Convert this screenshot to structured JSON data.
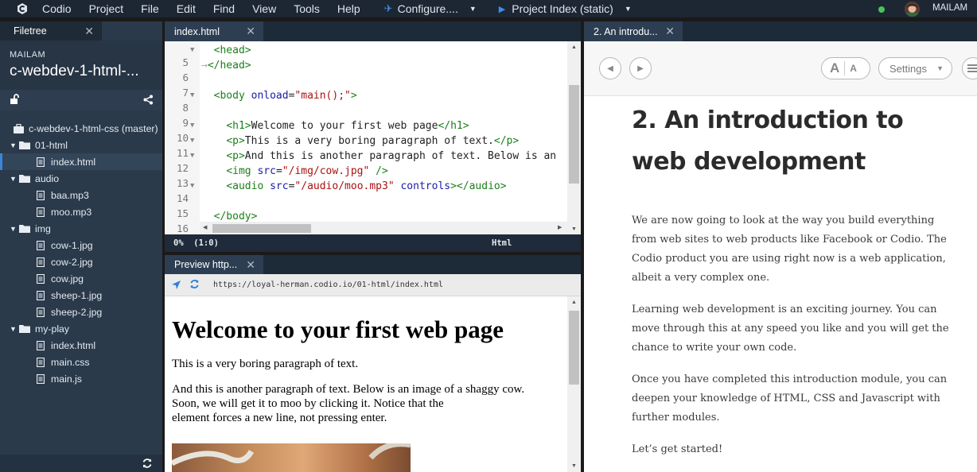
{
  "menubar": {
    "items": [
      "Codio",
      "Project",
      "File",
      "Edit",
      "Find",
      "View",
      "Tools",
      "Help"
    ],
    "configure": "Configure....",
    "project_index": "Project Index (static)",
    "user": "MAILAM"
  },
  "filetree": {
    "tab": "Filetree",
    "org": "MAILAM",
    "project": "c-webdev-1-html-...",
    "root": "c-webdev-1-html-css (master)",
    "items": [
      {
        "label": "01-html",
        "type": "folder"
      },
      {
        "label": "index.html",
        "type": "file",
        "selected": true
      },
      {
        "label": "audio",
        "type": "folder"
      },
      {
        "label": "baa.mp3",
        "type": "file"
      },
      {
        "label": "moo.mp3",
        "type": "file"
      },
      {
        "label": "img",
        "type": "folder"
      },
      {
        "label": "cow-1.jpg",
        "type": "file"
      },
      {
        "label": "cow-2.jpg",
        "type": "file"
      },
      {
        "label": "cow.jpg",
        "type": "file"
      },
      {
        "label": "sheep-1.jpg",
        "type": "file"
      },
      {
        "label": "sheep-2.jpg",
        "type": "file"
      },
      {
        "label": "my-play",
        "type": "folder"
      },
      {
        "label": "index.html",
        "type": "file"
      },
      {
        "label": "main.css",
        "type": "file"
      },
      {
        "label": "main.js",
        "type": "file"
      }
    ]
  },
  "editor": {
    "tab": "index.html",
    "lines": [
      {
        "n": "5",
        "fold": "▼"
      },
      {
        "n": "6",
        "fold": ""
      },
      {
        "n": "7",
        "fold": ""
      },
      {
        "n": "8",
        "fold": "▼"
      },
      {
        "n": "9",
        "fold": ""
      },
      {
        "n": "10",
        "fold": "▼"
      },
      {
        "n": "11",
        "fold": "▼"
      },
      {
        "n": "12",
        "fold": "▼"
      },
      {
        "n": "13",
        "fold": ""
      },
      {
        "n": "14",
        "fold": "▼"
      },
      {
        "n": "15",
        "fold": ""
      },
      {
        "n": "16",
        "fold": ""
      }
    ],
    "status_left": "0%  (1:0)",
    "mode": "Html"
  },
  "preview": {
    "tab": "Preview http...",
    "url": "https://loyal-herman.codio.io/01-html/index.html",
    "h1": "Welcome to your first web page",
    "p1": "This is a very boring paragraph of text.",
    "p2a": "And this is another paragraph of text. Below is an image of a shaggy cow.",
    "p2b": "Soon, we will get it to moo by clicking it. Notice that the",
    "p2c": "element forces a new line, not pressing enter."
  },
  "guide": {
    "tab": "2. An introdu...",
    "settings": "Settings",
    "title": "2. An introduction to web development",
    "paragraphs": [
      "We are now going to look at the way you build everything from web sites to web products like Facebook or Codio. The Codio product you are using right now is a web application, albeit a very complex one.",
      "Learning web development is an exciting journey. You can move through this at any speed you like and you will get the chance to write your own code.",
      "Once you have completed this introduction module, you can deepen your knowledge of HTML, CSS and Javascript with further modules.",
      "Let’s get started!"
    ]
  },
  "colors": {
    "menubar_bg": "#1d2633",
    "filetree_bg": "#2b3a4b",
    "selected_accent": "#3c86d8",
    "status_dot": "#49c35b"
  }
}
